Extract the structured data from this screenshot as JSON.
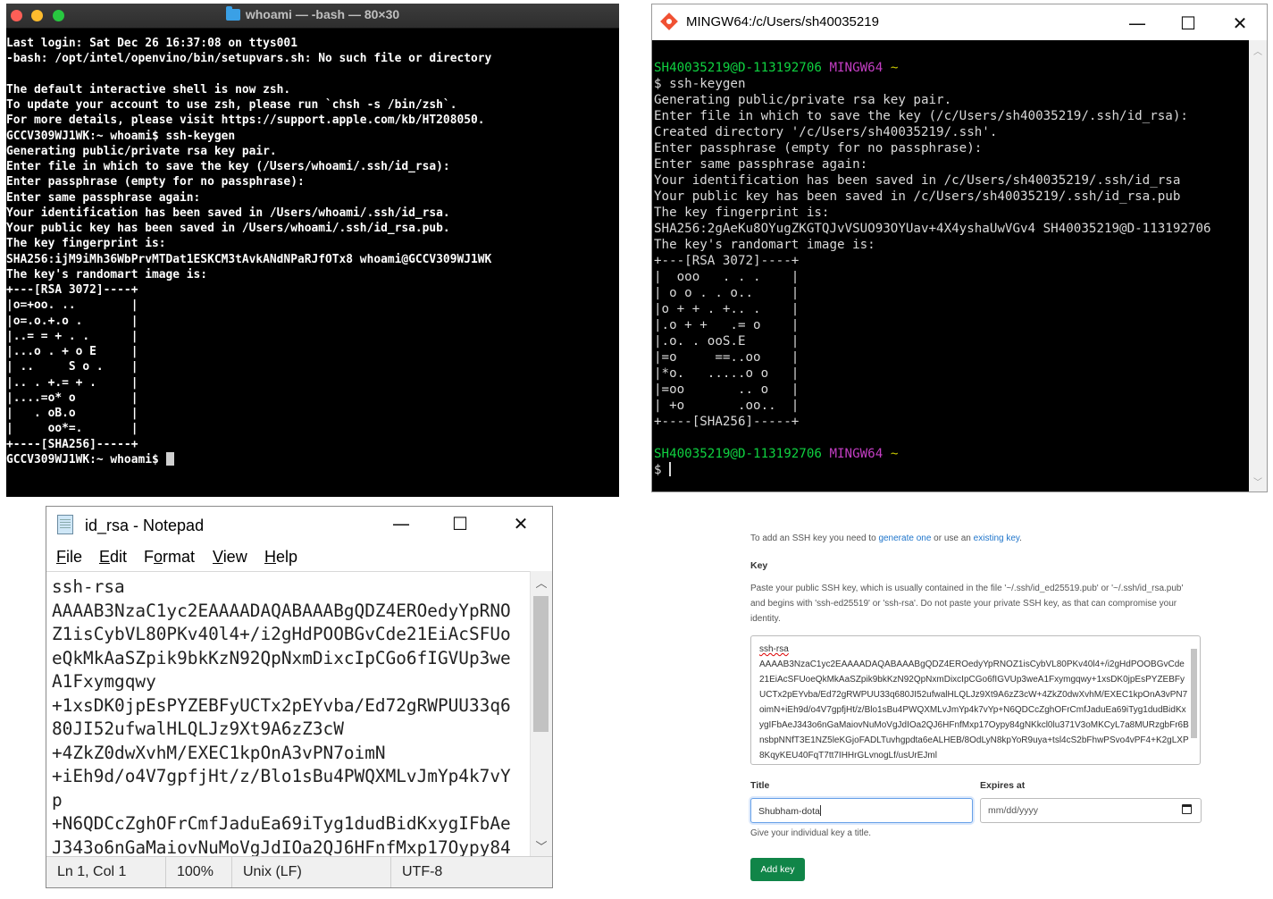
{
  "mac_terminal": {
    "title": "whoami — -bash — 80×30",
    "lines": [
      "Last login: Sat Dec 26 16:37:08 on ttys001",
      "-bash: /opt/intel/openvino/bin/setupvars.sh: No such file or directory",
      "",
      "The default interactive shell is now zsh.",
      "To update your account to use zsh, please run `chsh -s /bin/zsh`.",
      "For more details, please visit https://support.apple.com/kb/HT208050.",
      "GCCV309WJ1WK:~ whoami$ ssh-keygen",
      "Generating public/private rsa key pair.",
      "Enter file in which to save the key (/Users/whoami/.ssh/id_rsa):",
      "Enter passphrase (empty for no passphrase):",
      "Enter same passphrase again:",
      "Your identification has been saved in /Users/whoami/.ssh/id_rsa.",
      "Your public key has been saved in /Users/whoami/.ssh/id_rsa.pub.",
      "The key fingerprint is:",
      "SHA256:ijM9iMh36WbPrvMTDat1ESKCM3tAvkANdNPaRJfOTx8 whoami@GCCV309WJ1WK",
      "The key's randomart image is:",
      "+---[RSA 3072]----+",
      "|o=+oo. ..        |",
      "|o=.o.+.o .       |",
      "|..= = + . .      |",
      "|...o . + o E     |",
      "| ..     S o .    |",
      "|.. . +.= + .     |",
      "|....=o* o        |",
      "|   . oB.o        |",
      "|     oo*=.       |",
      "+----[SHA256]-----+"
    ],
    "prompt": "GCCV309WJ1WK:~ whoami$ "
  },
  "mingw": {
    "title": "MINGW64:/c/Users/sh40035219",
    "minimize": "—",
    "maximize": "☐",
    "close": "✕",
    "prompt_user": "SH40035219@D-113192706",
    "prompt_env": "MINGW64",
    "prompt_dir": "~",
    "lines": [
      "$ ssh-keygen",
      "Generating public/private rsa key pair.",
      "Enter file in which to save the key (/c/Users/sh40035219/.ssh/id_rsa):",
      "Created directory '/c/Users/sh40035219/.ssh'.",
      "Enter passphrase (empty for no passphrase):",
      "Enter same passphrase again:",
      "Your identification has been saved in /c/Users/sh40035219/.ssh/id_rsa",
      "Your public key has been saved in /c/Users/sh40035219/.ssh/id_rsa.pub",
      "The key fingerprint is:",
      "SHA256:2gAeKu8OYugZKGTQJvVSUO93OYUav+4X4yshaUwVGv4 SH40035219@D-113192706",
      "The key's randomart image is:",
      "+---[RSA 3072]----+",
      "|  ooo   . . .    |",
      "| o o . . o..     |",
      "|o + + . +.. .    |",
      "|.o + +   .= o    |",
      "|.o. . ooS.E      |",
      "|=o     ==..oo    |",
      "|*o.   .....o o   |",
      "|=oo       .. o   |",
      "| +o       .oo..  |",
      "+----[SHA256]-----+"
    ],
    "final_prompt": "$ "
  },
  "notepad": {
    "title": "id_rsa - Notepad",
    "minimize": "—",
    "maximize": "☐",
    "close": "✕",
    "menu": {
      "file": "File",
      "edit": "Edit",
      "format": "Format",
      "view": "View",
      "help": "Help"
    },
    "lines": [
      "ssh-rsa",
      "AAAAB3NzaC1yc2EAAAADAQABAAABgQDZ4EROedyYpRNO",
      "Z1isCybVL80PKv40l4+/i2gHdPOOBGvCde21EiAcSFUo",
      "eQkMkAaSZpik9bkKzN92QpNxmDixcIpCGo6fIGVUp3we",
      "A1Fxymgqwy",
      "+1xsDK0jpEsPYZEBFyUCTx2pEYvba/Ed72gRWPUU33q6",
      "80JI52ufwalHLQLJz9Xt9A6zZ3cW",
      "+4ZkZ0dwXvhM/EXEC1kpOnA3vPN7oimN",
      "+iEh9d/o4V7gpfjHt/z/Blo1sBu4PWQXMLvJmYp4k7vY",
      "p",
      "+N6QDCcZghOFrCmfJaduEa69iTyg1dudBidKxygIFbAe",
      "J343o6nGaMaiovNuMoVgJdIOa2QJ6HFnfMxp17Oypy84"
    ],
    "status": {
      "position": "Ln 1, Col 1",
      "zoom": "100%",
      "line_ending": "Unix (LF)",
      "encoding": "UTF-8"
    }
  },
  "gitlab_form": {
    "intro_prefix": "To add an SSH key you need to ",
    "intro_link1": "generate one",
    "intro_mid": " or use an ",
    "intro_link2": "existing key",
    "intro_suffix": ".",
    "key_label": "Key",
    "key_help": "Paste your public SSH key, which is usually contained in the file '~/.ssh/id_ed25519.pub' or '~/.ssh/id_rsa.pub' and begins with 'ssh-ed25519' or 'ssh-rsa'. Do not paste your private SSH key, as that can compromise your identity.",
    "key_first": "ssh-rsa",
    "key_value": "AAAAB3NzaC1yc2EAAAADAQABAAABgQDZ4EROedyYpRNOZ1isCybVL80PKv40l4+/i2gHdPOOBGvCde21EiAcSFUoeQkMkAaSZpik9bkKzN92QpNxmDixcIpCGo6fIGVUp3weA1Fxymgqwy+1xsDK0jpEsPYZEBFyUCTx2pEYvba/Ed72gRWPUU33q680JI52ufwalHLQLJz9Xt9A6zZ3cW+4ZkZ0dwXvhM/EXEC1kpOnA3vPN7oimN+iEh9d/o4V7gpfjHt/z/Blo1sBu4PWQXMLvJmYp4k7vYp+N6QDCcZghOFrCmfJaduEa69iTyg1dudBidKxygIFbAeJ343o6nGaMaiovNuMoVgJdIOa2QJ6HFnfMxp17Oypy84gNKkcl0lu371V3oMKCyL7a8MURzgbFr6BnsbpNNfT3E1NZ5leKGjoFADLTuvhgpdta6eALHEB/8OdLyN8kpYoR9uya+tsl4cS2bFhwPSvo4vPF4+K2gLXP8KqyKEU40FqT7tt7IHHrGLvnogLf/usUrEJml",
    "title_label": "Title",
    "title_value": "Shubham-dota",
    "title_help": "Give your individual key a title.",
    "expires_label": "Expires at",
    "expires_placeholder": "mm/dd/yyyy",
    "add_key_label": "Add key"
  }
}
